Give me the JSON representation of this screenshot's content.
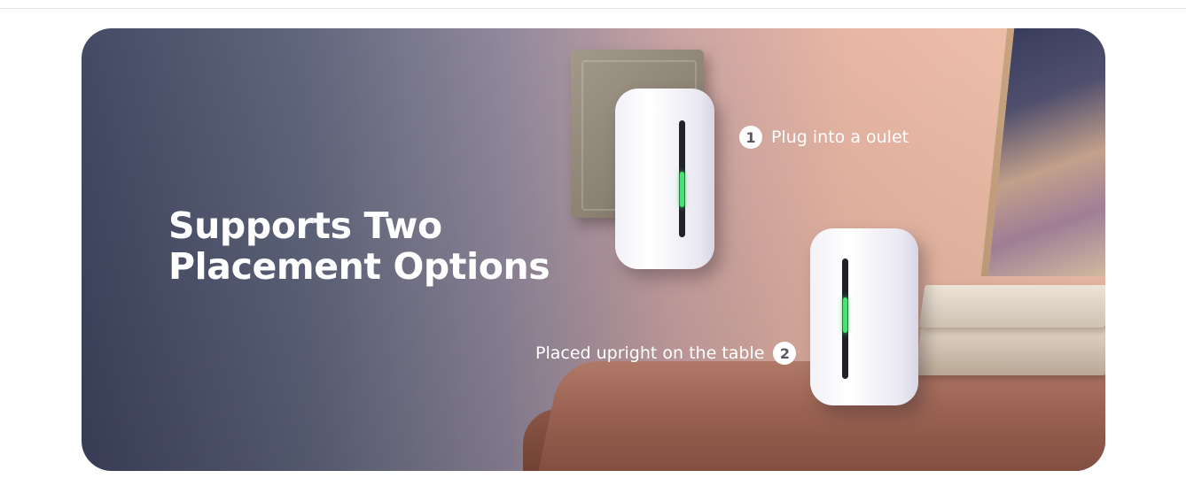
{
  "banner": {
    "headline_line_1": "Supports Two",
    "headline_line_2": "Placement Options"
  },
  "callouts": [
    {
      "number": "1",
      "label": "Plug into a oulet"
    },
    {
      "number": "2",
      "label": "Placed upright on the table"
    }
  ],
  "colors": {
    "background": "#ffffff",
    "gradient_left": "#3d435e",
    "gradient_right": "#efc0a8",
    "text": "#ffffff",
    "led": "#3ee86a"
  }
}
